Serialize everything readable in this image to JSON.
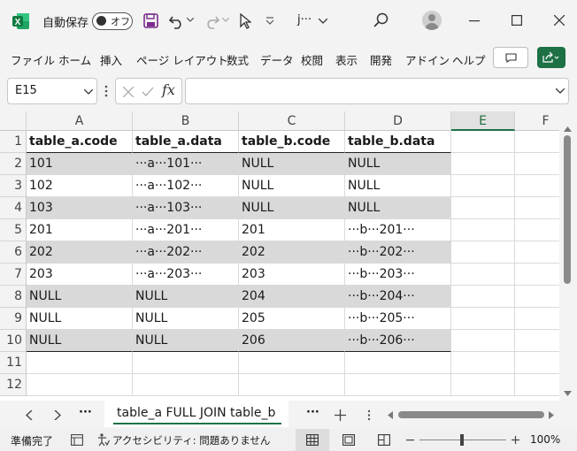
{
  "app": {
    "autosave_label": "自動保存",
    "autosave_state": "オフ",
    "file_name": "j···",
    "accent": "#1e7145"
  },
  "menu": [
    "ファイル",
    "ホーム",
    "挿入",
    "ページ レイアウト",
    "数式",
    "データ",
    "校閲",
    "表示",
    "開発",
    "アドイン",
    "ヘルプ"
  ],
  "formula_bar": {
    "name_box": "E15",
    "formula": ""
  },
  "sheet": {
    "columns": [
      "A",
      "B",
      "C",
      "D",
      "E",
      "F"
    ],
    "selected_column": "E",
    "row_numbers": [
      "1",
      "2",
      "3",
      "4",
      "5",
      "6",
      "7",
      "8",
      "9",
      "10",
      "11",
      "12"
    ],
    "rows": [
      [
        "table_a.code",
        "table_a.data",
        "table_b.code",
        "table_b.data"
      ],
      [
        "101",
        "···a···101···",
        "NULL",
        "NULL"
      ],
      [
        "102",
        "···a···102···",
        "NULL",
        "NULL"
      ],
      [
        "103",
        "···a···103···",
        "NULL",
        "NULL"
      ],
      [
        "201",
        "···a···201···",
        "201",
        "···b···201···"
      ],
      [
        "202",
        "···a···202···",
        "202",
        "···b···202···"
      ],
      [
        "203",
        "···a···203···",
        "203",
        "···b···203···"
      ],
      [
        "NULL",
        "NULL",
        "204",
        "···b···204···"
      ],
      [
        "NULL",
        "NULL",
        "205",
        "···b···205···"
      ],
      [
        "NULL",
        "NULL",
        "206",
        "···b···206···"
      ]
    ]
  },
  "sheet_tabs": {
    "active": "table_a FULL JOIN table_b",
    "more": "···"
  },
  "status": {
    "ready": "準備完了",
    "accessibility": "アクセシビリティ: 問題ありません",
    "zoom": "100%"
  }
}
